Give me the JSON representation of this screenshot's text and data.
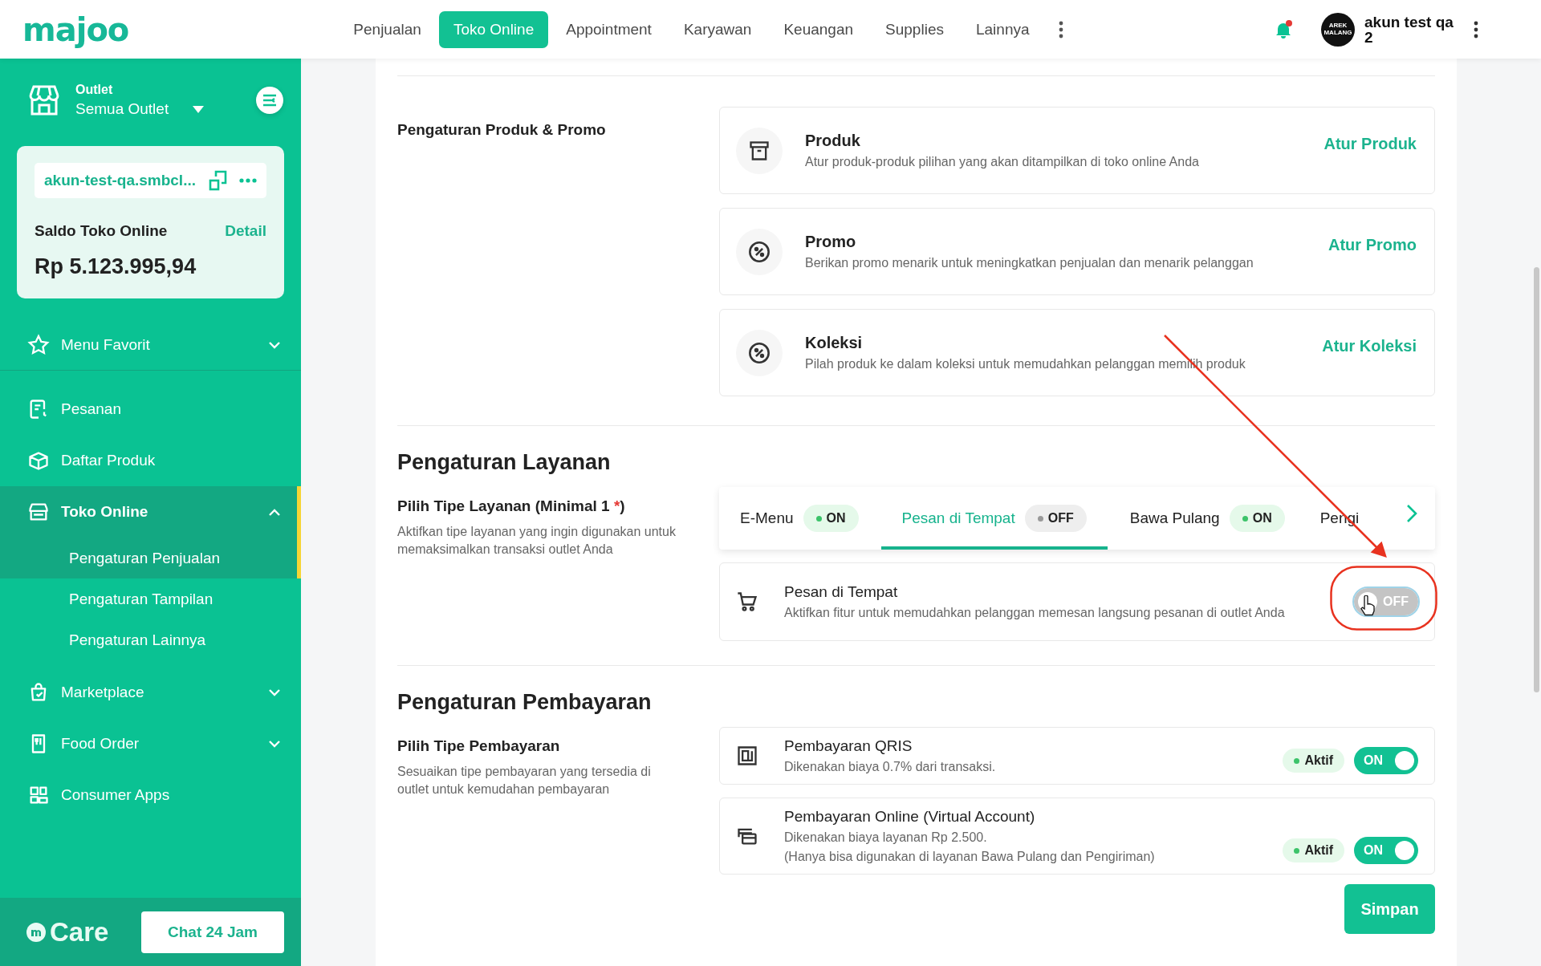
{
  "logo": "majoo",
  "top_nav": [
    {
      "label": "Penjualan",
      "selected": false
    },
    {
      "label": "Toko Online",
      "selected": true
    },
    {
      "label": "Appointment",
      "selected": false
    },
    {
      "label": "Karyawan",
      "selected": false
    },
    {
      "label": "Keuangan",
      "selected": false
    },
    {
      "label": "Supplies",
      "selected": false
    },
    {
      "label": "Lainnya",
      "selected": false
    }
  ],
  "notifications": {
    "unread": true
  },
  "user": {
    "avatar_text": "AREK MALANG",
    "name": "akun test qa 2"
  },
  "sidebar": {
    "outlet_label": "Outlet",
    "outlet_value": "Semua Outlet",
    "store_card": {
      "url": "akun-test-qa.smbcl...",
      "balance_label": "Saldo Toko Online",
      "detail_link": "Detail",
      "balance": "Rp 5.123.995,94"
    },
    "favorites": {
      "label": "Menu Favorit",
      "expanded": false
    },
    "menu": [
      {
        "label": "Pesanan",
        "selected": false
      },
      {
        "label": "Daftar Produk",
        "selected": false
      },
      {
        "label": "Toko Online",
        "selected": true,
        "expanded": true,
        "children": [
          {
            "label": "Pengaturan Penjualan",
            "selected": true
          },
          {
            "label": "Pengaturan Tampilan",
            "selected": false
          },
          {
            "label": "Pengaturan Lainnya",
            "selected": false
          }
        ]
      },
      {
        "label": "Marketplace",
        "selected": false,
        "expanded": false
      },
      {
        "label": "Food Order",
        "selected": false,
        "expanded": false
      },
      {
        "label": "Consumer Apps",
        "selected": false
      }
    ],
    "care": {
      "brand": "Care",
      "chat_button": "Chat 24 Jam"
    }
  },
  "product_settings": {
    "title": "Pengaturan Produk & Promo",
    "items": [
      {
        "title": "Produk",
        "description": "Atur produk-produk pilihan yang akan ditampilkan di toko online Anda",
        "action": "Atur Produk"
      },
      {
        "title": "Promo",
        "description": "Berikan promo menarik untuk meningkatkan penjualan dan menarik pelanggan",
        "action": "Atur Promo"
      },
      {
        "title": "Koleksi",
        "description": "Pilah produk ke dalam koleksi untuk memudahkan pelanggan memilih produk",
        "action": "Atur Koleksi"
      }
    ]
  },
  "service_settings": {
    "title": "Pengaturan Layanan",
    "label_start": "Pilih Tipe Layanan (Minimal 1 ",
    "required_mark": "*",
    "label_end": ")",
    "description": "Aktifkan tipe layanan yang ingin digunakan untuk memaksimalkan transaksi outlet Anda",
    "tabs": [
      {
        "label": "E-Menu",
        "status": "ON",
        "on": true,
        "selected": false
      },
      {
        "label": "Pesan di Tempat",
        "status": "OFF",
        "on": false,
        "selected": true
      },
      {
        "label": "Bawa Pulang",
        "status": "ON",
        "on": true,
        "selected": false
      },
      {
        "label": "Pengi",
        "selected": false
      }
    ],
    "detail": {
      "title": "Pesan di Tempat",
      "description": "Aktifkan fitur untuk memudahkan pelanggan memesan langsung pesanan di outlet Anda",
      "toggle": {
        "on": false,
        "label": "OFF"
      }
    }
  },
  "payment_settings": {
    "title": "Pengaturan Pembayaran",
    "subtitle": "Pilih Tipe Pembayaran",
    "description": "Sesuaikan tipe pembayaran yang tersedia di outlet untuk kemudahan pembayaran",
    "methods": [
      {
        "title": "Pembayaran QRIS",
        "description": [
          "Dikenakan biaya 0.7% dari transaksi."
        ],
        "badge": "Aktif",
        "toggle": {
          "on": true,
          "label": "ON"
        }
      },
      {
        "title": "Pembayaran Online (Virtual Account)",
        "description": [
          "Dikenakan biaya layanan Rp 2.500.",
          "(Hanya bisa digunakan di layanan Bawa Pulang dan Pengiriman)"
        ],
        "badge": "Aktif",
        "toggle": {
          "on": true,
          "label": "ON"
        }
      }
    ]
  },
  "save_button": "Simpan"
}
